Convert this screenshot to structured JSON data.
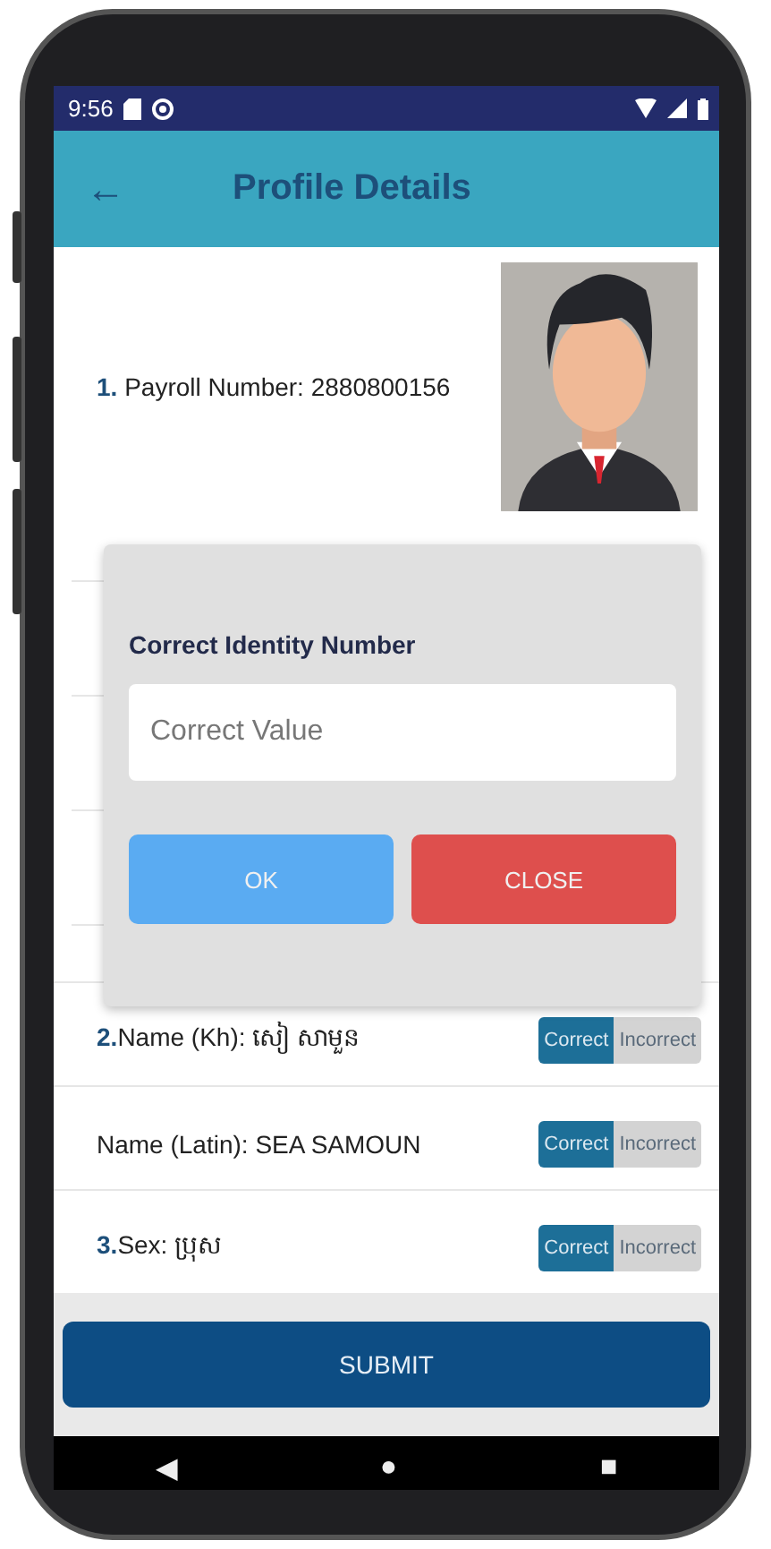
{
  "status_bar": {
    "time": "9:56"
  },
  "app_bar": {
    "back": "←",
    "title": "Profile Details"
  },
  "profile": {
    "number": "1.",
    "label": "Payroll Number: 2880800156"
  },
  "rows": [
    {
      "number": "2.",
      "label": "Name (Kh): សៀ សាមួន",
      "options": [
        {
          "label": "Correct",
          "selected": true
        },
        {
          "label": "Incorrect",
          "selected": false
        }
      ]
    },
    {
      "number": "",
      "label": "Name (Latin): SEA SAMOUN",
      "options": [
        {
          "label": "Correct",
          "selected": true
        },
        {
          "label": "Incorrect",
          "selected": false
        }
      ]
    },
    {
      "number": "3.",
      "label": "Sex: ប្រុស",
      "options": [
        {
          "label": "Correct",
          "selected": true
        },
        {
          "label": "Incorrect",
          "selected": false
        }
      ]
    }
  ],
  "dialog": {
    "title": "Correct Identity Number",
    "placeholder": "Correct Value",
    "buttons": [
      {
        "label": "OK",
        "kind": "ok"
      },
      {
        "label": "CLOSE",
        "kind": "close"
      }
    ]
  },
  "submit": "SUBMIT",
  "nav_bar": {
    "back": "◀",
    "home": "●",
    "recent": "■"
  }
}
